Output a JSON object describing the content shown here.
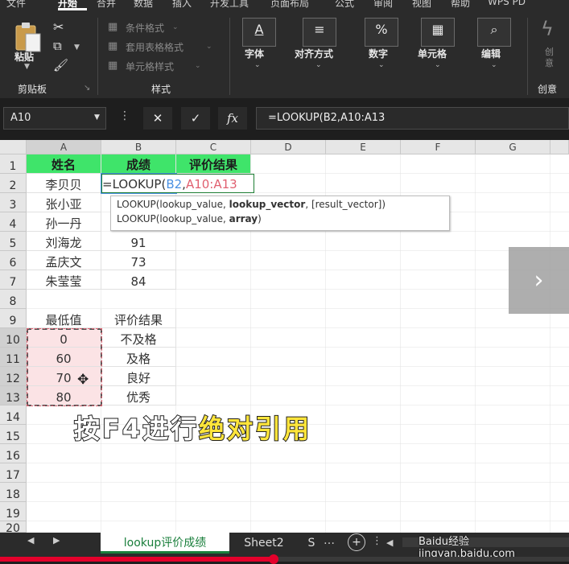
{
  "menu": {
    "items": [
      "文件",
      "开始",
      "合并",
      "数据",
      "插入",
      "开发工具",
      "页面布局",
      "公式",
      "审阅",
      "视图",
      "帮助",
      "WPS PD"
    ],
    "active_index": 1
  },
  "ribbon": {
    "clipboard": {
      "paste_label": "粘贴",
      "group_label": "剪贴板"
    },
    "styles": {
      "conditional_format": "条件格式",
      "table_format": "套用表格格式",
      "cell_style": "单元格样式",
      "group_label": "样式"
    },
    "buttons": {
      "font": "字体",
      "alignment": "对齐方式",
      "number": "数字",
      "cells": "单元格",
      "editing": "编辑",
      "create": "创意"
    },
    "creative_group_label": "创意"
  },
  "formula_bar": {
    "name_box": "A10",
    "formula": "=LOOKUP(B2,A10:A13",
    "fx_label": "fx"
  },
  "grid": {
    "columns": [
      "A",
      "B",
      "C",
      "D",
      "E",
      "F",
      "G"
    ],
    "rows": [
      "1",
      "2",
      "3",
      "4",
      "5",
      "6",
      "7",
      "8",
      "9",
      "10",
      "11",
      "12",
      "13",
      "14",
      "15",
      "16",
      "17",
      "18",
      "19",
      "20"
    ],
    "header_name": "姓名",
    "header_score": "成绩",
    "header_result": "评价结果",
    "names": [
      "李贝贝",
      "张小亚",
      "孙一丹",
      "刘海龙",
      "孟庆文",
      "朱莹莹"
    ],
    "scores": [
      "",
      "",
      "",
      "91",
      "73",
      "84"
    ],
    "editing_cell": {
      "prefix": "=LOOKUP(",
      "ref1": "B2",
      "comma": ",",
      "ref2": "A10:A13"
    },
    "lookup_header_min": "最低值",
    "lookup_header_result": "评价结果",
    "lookup_min": [
      "0",
      "60",
      "70",
      "80"
    ],
    "lookup_result": [
      "不及格",
      "及格",
      "良好",
      "优秀"
    ]
  },
  "tooltip": {
    "line1_a": "LOOKUP(lookup_value, ",
    "line1_b": "lookup_vector",
    "line1_c": ", [result_vector])",
    "line2_a": "LOOKUP(lookup_value, ",
    "line2_b": "array",
    "line2_c": ")"
  },
  "caption": {
    "part1": "按F4进行",
    "part2": "绝对引用"
  },
  "sheet_tabs": {
    "active": "lookup评价成绩",
    "second": "Sheet2",
    "third": "S"
  },
  "watermark": "Baidu经验 jingyan.baidu.com"
}
